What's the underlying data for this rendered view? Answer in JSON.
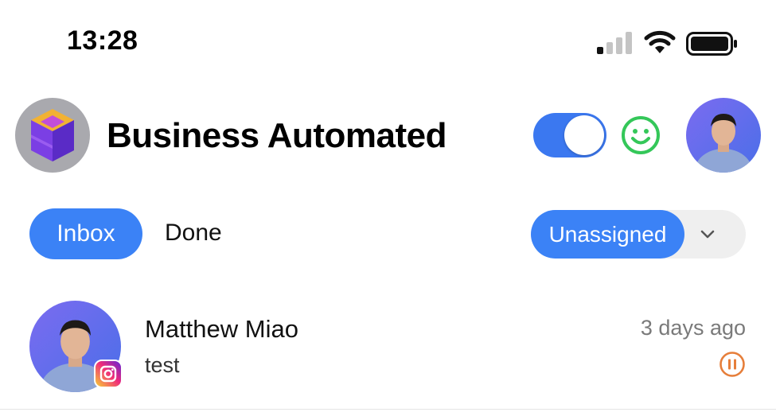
{
  "status_bar": {
    "time": "13:28",
    "icons": [
      "cellular-signal-icon",
      "wifi-icon",
      "battery-icon"
    ]
  },
  "header": {
    "org_name": "Business Automated",
    "available_toggle_on": true,
    "mood_icon": "smiley-icon"
  },
  "tabs": {
    "inbox_label": "Inbox",
    "done_label": "Done",
    "active": "Inbox"
  },
  "filter": {
    "assignment_label": "Unassigned"
  },
  "conversations": [
    {
      "name": "Matthew Miao",
      "preview": "test",
      "time": "3 days ago",
      "channel_icon": "instagram-icon",
      "status_icon": "pause-icon"
    }
  ],
  "colors": {
    "accent": "#3b82f6",
    "toggle": "#3b78f0",
    "mood_green": "#34c759",
    "pause_orange": "#e67e3a"
  }
}
